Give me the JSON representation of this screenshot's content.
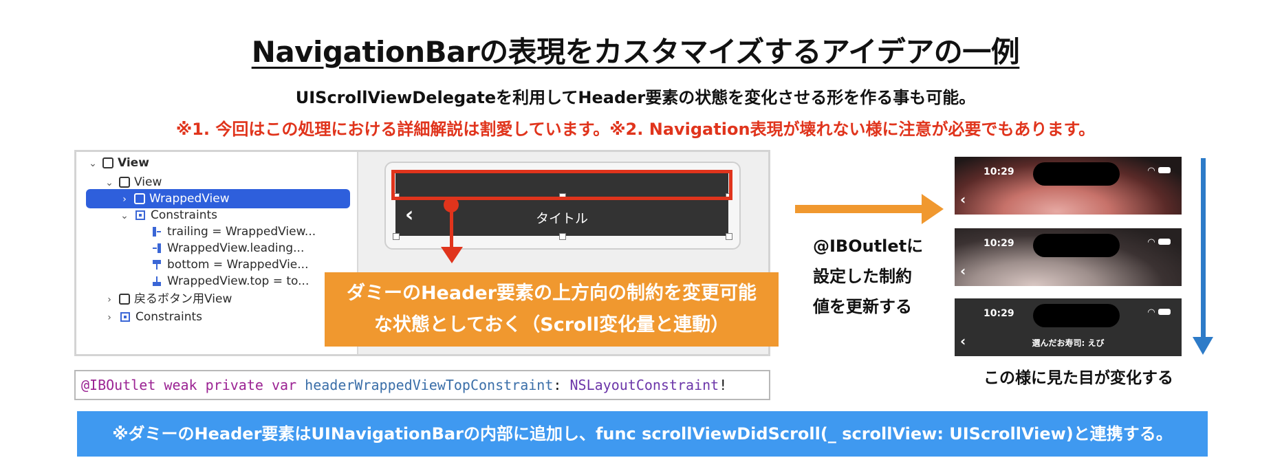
{
  "title": "NavigationBarの表現をカスタマイズするアイデアの一例",
  "subtitle": "UIScrollViewDelegateを利用してHeader要素の状態を変化させる形を作る事も可能。",
  "notes": "※1. 今回はこの処理における詳細解説は割愛しています。※2. Navigation表現が壊れない様に注意が必要でもあります。",
  "outline": {
    "items": [
      {
        "label": "View"
      },
      {
        "label": "View"
      },
      {
        "label": "WrappedView"
      },
      {
        "label": "Constraints"
      },
      {
        "label": "trailing = WrappedView..."
      },
      {
        "label": "WrappedView.leading..."
      },
      {
        "label": "bottom = WrappedVie..."
      },
      {
        "label": "WrappedView.top = to..."
      },
      {
        "label": "戻るボタン用View"
      },
      {
        "label": "Constraints"
      }
    ]
  },
  "canvas": {
    "nav_title": "タイトル",
    "back_glyph": "‹"
  },
  "callout": {
    "line1": "ダミーのHeader要素の上方向の制約を変更可能",
    "line2": "な状態としておく（Scroll変化量と連動）"
  },
  "code": {
    "attr": "@IBOutlet",
    "kw1": "weak",
    "kw2": "private",
    "kw3": "var",
    "name": "headerWrappedViewTopConstraint",
    "colon": ":",
    "type": "NSLayoutConstraint",
    "bang": "!"
  },
  "arrow_text": {
    "line1": "@IBOutletに",
    "line2": "設定した制約",
    "line3": "値を更新する"
  },
  "shots": [
    {
      "time": "10:29",
      "title": ""
    },
    {
      "time": "10:29",
      "title": ""
    },
    {
      "time": "10:29",
      "title": "選んだお寿司: えび"
    }
  ],
  "change_caption": "この様に見た目が変化する",
  "banner": "※ダミーのHeader要素はUINavigationBarの内部に追加し、func scrollViewDidScroll(_ scrollView: UIScrollView)と連携する。",
  "colors": {
    "accent_red": "#e0341c",
    "accent_orange": "#f0982f",
    "accent_blue": "#3f99f0",
    "selection_blue": "#2e5fdc",
    "arrow_blue": "#2d7bc8"
  }
}
